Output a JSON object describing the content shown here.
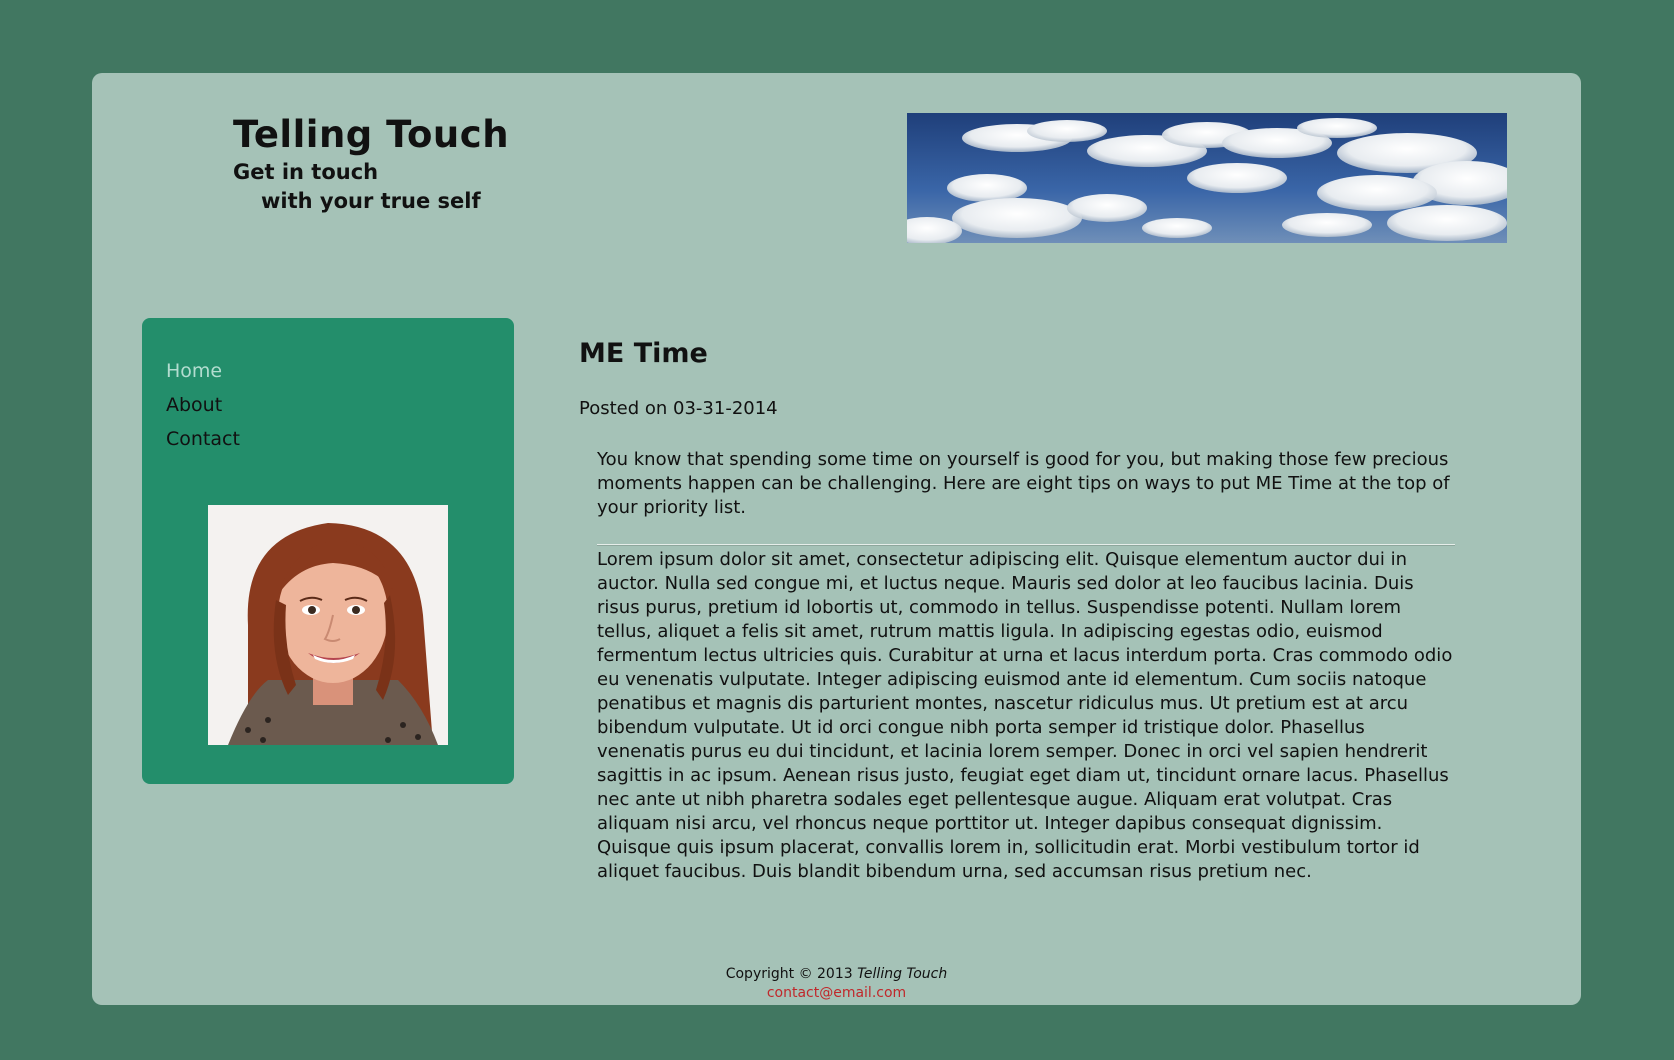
{
  "header": {
    "title": "Telling Touch",
    "tagline_line1": "Get in touch",
    "tagline_line2": "with your true self"
  },
  "nav": {
    "items": [
      {
        "label": "Home",
        "active": true
      },
      {
        "label": "About",
        "active": false
      },
      {
        "label": "Contact",
        "active": false
      }
    ]
  },
  "post": {
    "title": "ME Time",
    "date_line": "Posted on 03-31-2014",
    "intro": "You know that spending some time on yourself is good for you, but making those few precious moments happen can be challenging. Here are eight tips on ways to put ME Time at the top of your priority list.",
    "body": "Lorem ipsum dolor sit amet, consectetur adipiscing elit. Quisque elementum auctor dui in auctor. Nulla sed congue mi, et luctus neque. Mauris sed dolor at leo faucibus lacinia. Duis risus purus, pretium id lobortis ut, commodo in tellus. Suspendisse potenti. Nullam lorem tellus, aliquet a felis sit amet, rutrum mattis ligula. In adipiscing egestas odio, euismod fermentum lectus ultricies quis. Curabitur at urna et lacus interdum porta. Cras commodo odio eu venenatis vulputate. Integer adipiscing euismod ante id elementum. Cum sociis natoque penatibus et magnis dis parturient montes, nascetur ridiculus mus. Ut pretium est at arcu bibendum vulputate. Ut id orci congue nibh porta semper id tristique dolor. Phasellus venenatis purus eu dui tincidunt, et lacinia lorem semper. Donec in orci vel sapien hendrerit sagittis in ac ipsum. Aenean risus justo, feugiat eget diam ut, tincidunt ornare lacus. Phasellus nec ante ut nibh pharetra sodales eget pellentesque augue. Aliquam erat volutpat. Cras aliquam nisi arcu, vel rhoncus neque porttitor ut. Integer dapibus consequat dignissim. Quisque quis ipsum placerat, convallis lorem in, sollicitudin erat. Morbi vestibulum tortor id aliquet faucibus. Duis blandit bibendum urna, sed accumsan risus pretium nec."
  },
  "footer": {
    "copyright_prefix": "Copyright © 2013",
    "brand": "Telling Touch",
    "email": "contact@email.com"
  },
  "colors": {
    "outer_background": "#417761",
    "page_background": "#a5c2b7",
    "sidebar_background": "#238e6b",
    "nav_active": "#b3ddd0",
    "email_link": "#c0282b"
  },
  "images": {
    "header": "sky-clouds-banner",
    "portrait": "woman-portrait-photo"
  }
}
